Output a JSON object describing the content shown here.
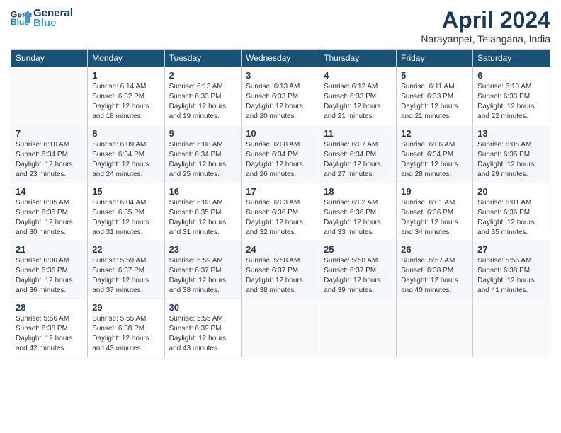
{
  "header": {
    "logo_line1": "General",
    "logo_line2": "Blue",
    "month_title": "April 2024",
    "location": "Narayanpet, Telangana, India"
  },
  "weekdays": [
    "Sunday",
    "Monday",
    "Tuesday",
    "Wednesday",
    "Thursday",
    "Friday",
    "Saturday"
  ],
  "weeks": [
    [
      {
        "day": "",
        "info": ""
      },
      {
        "day": "1",
        "info": "Sunrise: 6:14 AM\nSunset: 6:32 PM\nDaylight: 12 hours\nand 18 minutes."
      },
      {
        "day": "2",
        "info": "Sunrise: 6:13 AM\nSunset: 6:33 PM\nDaylight: 12 hours\nand 19 minutes."
      },
      {
        "day": "3",
        "info": "Sunrise: 6:13 AM\nSunset: 6:33 PM\nDaylight: 12 hours\nand 20 minutes."
      },
      {
        "day": "4",
        "info": "Sunrise: 6:12 AM\nSunset: 6:33 PM\nDaylight: 12 hours\nand 21 minutes."
      },
      {
        "day": "5",
        "info": "Sunrise: 6:11 AM\nSunset: 6:33 PM\nDaylight: 12 hours\nand 21 minutes."
      },
      {
        "day": "6",
        "info": "Sunrise: 6:10 AM\nSunset: 6:33 PM\nDaylight: 12 hours\nand 22 minutes."
      }
    ],
    [
      {
        "day": "7",
        "info": "Sunrise: 6:10 AM\nSunset: 6:34 PM\nDaylight: 12 hours\nand 23 minutes."
      },
      {
        "day": "8",
        "info": "Sunrise: 6:09 AM\nSunset: 6:34 PM\nDaylight: 12 hours\nand 24 minutes."
      },
      {
        "day": "9",
        "info": "Sunrise: 6:08 AM\nSunset: 6:34 PM\nDaylight: 12 hours\nand 25 minutes."
      },
      {
        "day": "10",
        "info": "Sunrise: 6:08 AM\nSunset: 6:34 PM\nDaylight: 12 hours\nand 26 minutes."
      },
      {
        "day": "11",
        "info": "Sunrise: 6:07 AM\nSunset: 6:34 PM\nDaylight: 12 hours\nand 27 minutes."
      },
      {
        "day": "12",
        "info": "Sunrise: 6:06 AM\nSunset: 6:34 PM\nDaylight: 12 hours\nand 28 minutes."
      },
      {
        "day": "13",
        "info": "Sunrise: 6:05 AM\nSunset: 6:35 PM\nDaylight: 12 hours\nand 29 minutes."
      }
    ],
    [
      {
        "day": "14",
        "info": "Sunrise: 6:05 AM\nSunset: 6:35 PM\nDaylight: 12 hours\nand 30 minutes."
      },
      {
        "day": "15",
        "info": "Sunrise: 6:04 AM\nSunset: 6:35 PM\nDaylight: 12 hours\nand 31 minutes."
      },
      {
        "day": "16",
        "info": "Sunrise: 6:03 AM\nSunset: 6:35 PM\nDaylight: 12 hours\nand 31 minutes."
      },
      {
        "day": "17",
        "info": "Sunrise: 6:03 AM\nSunset: 6:36 PM\nDaylight: 12 hours\nand 32 minutes."
      },
      {
        "day": "18",
        "info": "Sunrise: 6:02 AM\nSunset: 6:36 PM\nDaylight: 12 hours\nand 33 minutes."
      },
      {
        "day": "19",
        "info": "Sunrise: 6:01 AM\nSunset: 6:36 PM\nDaylight: 12 hours\nand 34 minutes."
      },
      {
        "day": "20",
        "info": "Sunrise: 6:01 AM\nSunset: 6:36 PM\nDaylight: 12 hours\nand 35 minutes."
      }
    ],
    [
      {
        "day": "21",
        "info": "Sunrise: 6:00 AM\nSunset: 6:36 PM\nDaylight: 12 hours\nand 36 minutes."
      },
      {
        "day": "22",
        "info": "Sunrise: 5:59 AM\nSunset: 6:37 PM\nDaylight: 12 hours\nand 37 minutes."
      },
      {
        "day": "23",
        "info": "Sunrise: 5:59 AM\nSunset: 6:37 PM\nDaylight: 12 hours\nand 38 minutes."
      },
      {
        "day": "24",
        "info": "Sunrise: 5:58 AM\nSunset: 6:37 PM\nDaylight: 12 hours\nand 38 minutes."
      },
      {
        "day": "25",
        "info": "Sunrise: 5:58 AM\nSunset: 6:37 PM\nDaylight: 12 hours\nand 39 minutes."
      },
      {
        "day": "26",
        "info": "Sunrise: 5:57 AM\nSunset: 6:38 PM\nDaylight: 12 hours\nand 40 minutes."
      },
      {
        "day": "27",
        "info": "Sunrise: 5:56 AM\nSunset: 6:38 PM\nDaylight: 12 hours\nand 41 minutes."
      }
    ],
    [
      {
        "day": "28",
        "info": "Sunrise: 5:56 AM\nSunset: 6:38 PM\nDaylight: 12 hours\nand 42 minutes."
      },
      {
        "day": "29",
        "info": "Sunrise: 5:55 AM\nSunset: 6:38 PM\nDaylight: 12 hours\nand 43 minutes."
      },
      {
        "day": "30",
        "info": "Sunrise: 5:55 AM\nSunset: 6:39 PM\nDaylight: 12 hours\nand 43 minutes."
      },
      {
        "day": "",
        "info": ""
      },
      {
        "day": "",
        "info": ""
      },
      {
        "day": "",
        "info": ""
      },
      {
        "day": "",
        "info": ""
      }
    ]
  ]
}
